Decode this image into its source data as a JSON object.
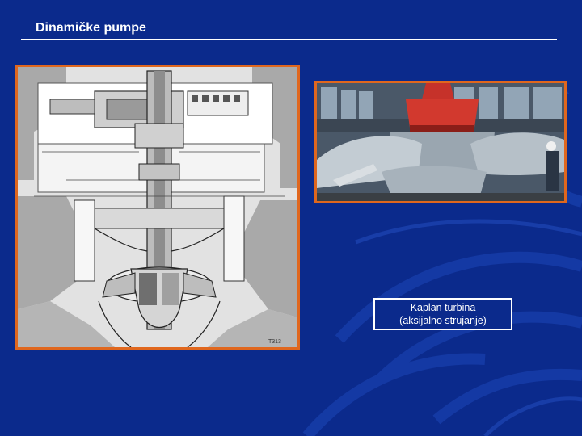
{
  "slide": {
    "title": "Dinamičke pumpe",
    "caption_line1": "Kaplan turbina",
    "caption_line2": "(aksijalno strujanje)",
    "drawing_label_code": "T313"
  },
  "colors": {
    "background": "#0b2a8c",
    "frame_accent": "#e0671e",
    "text": "#ffffff"
  },
  "images": [
    {
      "name": "kaplan-turbine-section-drawing"
    },
    {
      "name": "kaplan-runner-photo"
    }
  ]
}
